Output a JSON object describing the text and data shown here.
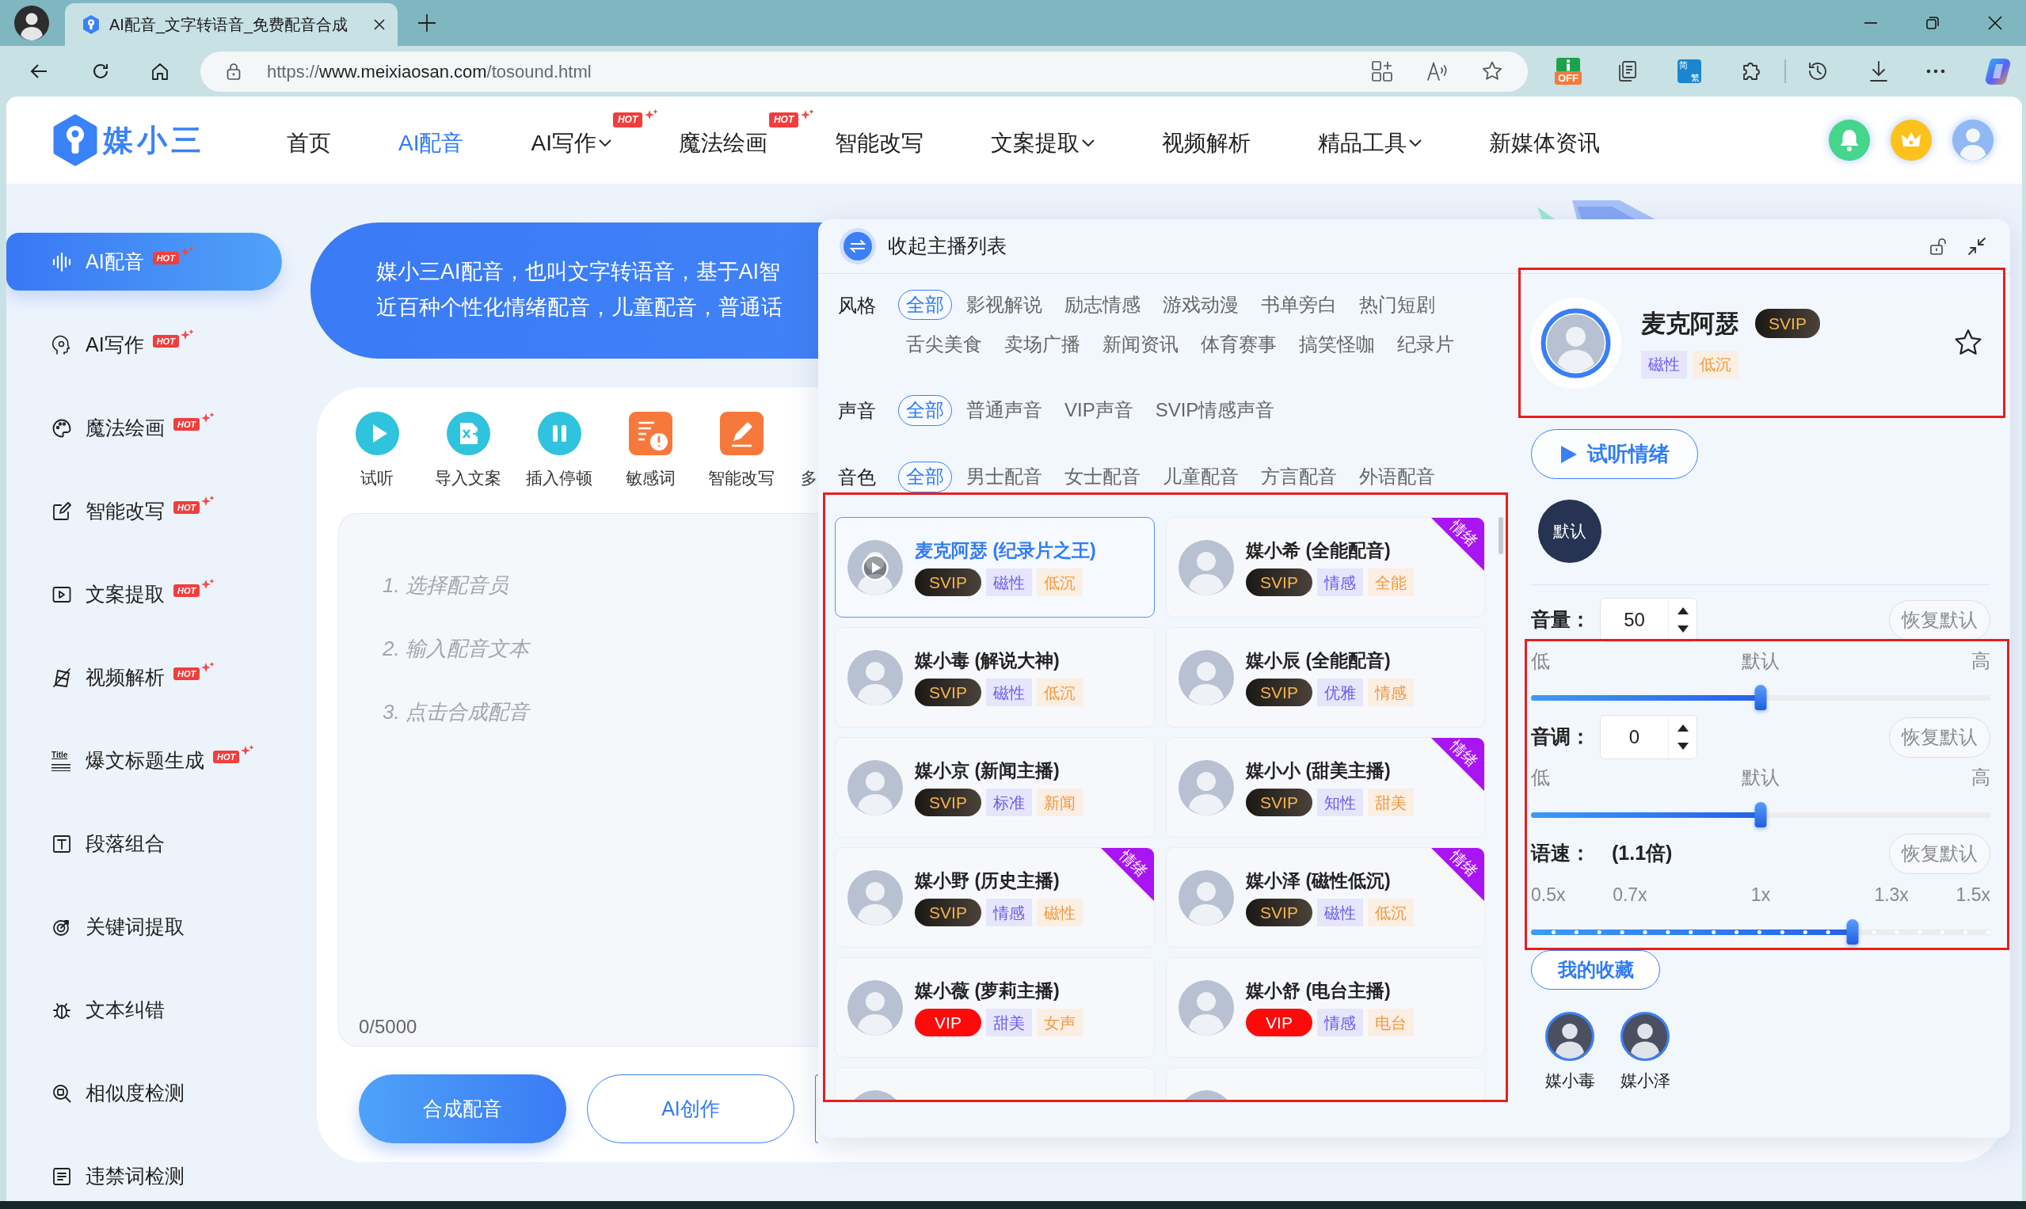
{
  "browser": {
    "tab_title": "AI配音_文字转语音_免费配音合成",
    "url": "https://www.meixiaosan.com/tosound.html",
    "extension_badge": "OFF",
    "translate_badge": [
      "简",
      "繁"
    ]
  },
  "header": {
    "logo": "媒小三",
    "nav": [
      {
        "label": "首页",
        "selected": false,
        "dropdown": false
      },
      {
        "label": "AI配音",
        "selected": true,
        "dropdown": false
      },
      {
        "label": "AI写作",
        "selected": false,
        "dropdown": true,
        "badge": "HOT"
      },
      {
        "label": "魔法绘画",
        "selected": false,
        "dropdown": false,
        "badge": "HOT"
      },
      {
        "label": "智能改写",
        "selected": false,
        "dropdown": false
      },
      {
        "label": "文案提取",
        "selected": false,
        "dropdown": true
      },
      {
        "label": "视频解析",
        "selected": false,
        "dropdown": false
      },
      {
        "label": "精品工具",
        "selected": false,
        "dropdown": true
      },
      {
        "label": "新媒体资讯",
        "selected": false,
        "dropdown": false
      }
    ]
  },
  "sidebar": {
    "items": [
      {
        "label": "AI配音",
        "selected": true,
        "badge": "HOT"
      },
      {
        "label": "AI写作",
        "selected": false,
        "badge": "HOT"
      },
      {
        "label": "魔法绘画",
        "selected": false,
        "badge": "HOT"
      },
      {
        "label": "智能改写",
        "selected": false,
        "badge": "HOT"
      },
      {
        "label": "文案提取",
        "selected": false,
        "badge": "HOT"
      },
      {
        "label": "视频解析",
        "selected": false,
        "badge": "HOT"
      },
      {
        "label": "爆文标题生成",
        "selected": false,
        "badge": "HOT",
        "icon_text": "Title"
      },
      {
        "label": "段落组合",
        "selected": false
      },
      {
        "label": "关键词提取",
        "selected": false
      },
      {
        "label": "文本纠错",
        "selected": false
      },
      {
        "label": "相似度检测",
        "selected": false
      },
      {
        "label": "违禁词检测",
        "selected": false
      }
    ]
  },
  "banner": {
    "lines": [
      "媒小三AI配音，也叫文字转语音，基于AI智",
      "近百种个性化情绪配音，儿童配音，普通话"
    ]
  },
  "editor": {
    "tools": [
      {
        "label": "试听"
      },
      {
        "label": "导入文案"
      },
      {
        "label": "插入停顿"
      },
      {
        "label": "敏感词"
      },
      {
        "label": "智能改写"
      },
      {
        "label": "多",
        "clipped": true
      }
    ],
    "placeholder": [
      "1. 选择配音员",
      "2. 输入配音文本",
      "3. 点击合成配音"
    ],
    "counter": "0/5000",
    "buttons": [
      {
        "label": "合成配音",
        "kind": "primary"
      },
      {
        "label": "AI创作",
        "kind": "outline"
      },
      {
        "kind": "outline"
      }
    ]
  },
  "voice_panel": {
    "collapse_label": "收起主播列表",
    "filters": [
      {
        "label": "风格",
        "options": [
          {
            "label": "全部",
            "selected": true
          },
          {
            "label": "影视解说",
            "selected": false
          },
          {
            "label": "励志情感",
            "selected": false
          },
          {
            "label": "游戏动漫",
            "selected": false
          },
          {
            "label": "书单旁白",
            "selected": false
          },
          {
            "label": "热门短剧",
            "selected": false
          },
          {
            "label": "舌尖美食",
            "selected": false
          },
          {
            "label": "卖场广播",
            "selected": false
          },
          {
            "label": "新闻资讯",
            "selected": false
          },
          {
            "label": "体育赛事",
            "selected": false
          },
          {
            "label": "搞笑怪咖",
            "selected": false
          },
          {
            "label": "纪录片",
            "selected": false
          }
        ]
      },
      {
        "label": "声音",
        "options": [
          {
            "label": "全部",
            "selected": true
          },
          {
            "label": "普通声音",
            "selected": false
          },
          {
            "label": "VIP声音",
            "selected": false
          },
          {
            "label": "SVIP情感声音",
            "selected": false
          }
        ]
      },
      {
        "label": "音色",
        "options": [
          {
            "label": "全部",
            "selected": true
          },
          {
            "label": "男士配音",
            "selected": false
          },
          {
            "label": "女士配音",
            "selected": false
          },
          {
            "label": "儿童配音",
            "selected": false
          },
          {
            "label": "方言配音",
            "selected": false
          },
          {
            "label": "外语配音",
            "selected": false
          }
        ]
      }
    ],
    "voice_list": {
      "highlighted": true,
      "items": [
        {
          "kind": "full",
          "name": "麦克阿瑟 (纪录片之王)",
          "tier": {
            "label": "SVIP",
            "kind": "svip"
          },
          "tags": [
            "磁性",
            "低沉"
          ],
          "selected": true
        },
        {
          "kind": "full",
          "name": "媒小希 (全能配音)",
          "tier": {
            "label": "SVIP",
            "kind": "svip"
          },
          "tags": [
            "情感",
            "全能"
          ],
          "selected": false,
          "ribbon": "情绪"
        },
        {
          "kind": "full",
          "name": "媒小毒 (解说大神)",
          "tier": {
            "label": "SVIP",
            "kind": "svip"
          },
          "tags": [
            "磁性",
            "低沉"
          ],
          "selected": false
        },
        {
          "kind": "full",
          "name": "媒小辰 (全能配音)",
          "tier": {
            "label": "SVIP",
            "kind": "svip"
          },
          "tags": [
            "优雅",
            "情感"
          ],
          "selected": false
        },
        {
          "kind": "full",
          "name": "媒小京 (新闻主播)",
          "tier": {
            "label": "SVIP",
            "kind": "svip"
          },
          "tags": [
            "标准",
            "新闻"
          ],
          "selected": false
        },
        {
          "kind": "full",
          "name": "媒小小 (甜美主播)",
          "tier": {
            "label": "SVIP",
            "kind": "svip"
          },
          "tags": [
            "知性",
            "甜美"
          ],
          "selected": false,
          "ribbon": "情绪"
        },
        {
          "kind": "full",
          "name": "媒小野 (历史主播)",
          "tier": {
            "label": "SVIP",
            "kind": "svip"
          },
          "tags": [
            "情感",
            "磁性"
          ],
          "selected": false,
          "ribbon": "情绪"
        },
        {
          "kind": "full",
          "name": "媒小泽 (磁性低沉)",
          "tier": {
            "label": "SVIP",
            "kind": "svip"
          },
          "tags": [
            "磁性",
            "低沉"
          ],
          "selected": false,
          "ribbon": "情绪"
        },
        {
          "kind": "full",
          "name": "媒小薇 (萝莉主播)",
          "tier": {
            "label": "VIP",
            "kind": "vip"
          },
          "tags": [
            "甜美",
            "女声"
          ],
          "selected": false
        },
        {
          "kind": "full",
          "name": "媒小舒 (电台主播)",
          "tier": {
            "label": "VIP",
            "kind": "vip"
          },
          "tags": [
            "情感",
            "电台"
          ],
          "selected": false
        },
        {
          "kind": "partial",
          "selected": false
        },
        {
          "kind": "partial",
          "selected": false
        }
      ]
    },
    "detail": {
      "highlighted": true,
      "name": "麦克阿瑟",
      "tier": {
        "label": "SVIP",
        "kind": "svip"
      },
      "tags": [
        "磁性",
        "低沉"
      ],
      "favorite": false,
      "preview_label": "试听情绪",
      "emotions": [
        {
          "label": "默认",
          "selected": true
        }
      ]
    },
    "adjustments": {
      "highlighted": true,
      "volume": {
        "label": "音量：",
        "value": "50",
        "reset": "恢复默认",
        "scale": [
          "低",
          "默认",
          "高"
        ],
        "level": 0.5
      },
      "pitch": {
        "label": "音调：",
        "value": "0",
        "reset": "恢复默认",
        "scale": [
          "低",
          "默认",
          "高"
        ],
        "level": 0.5
      },
      "speed": {
        "label": "语速：",
        "value": "(1.1倍)",
        "reset": "恢复默认",
        "ticks": [
          "0.5x",
          "0.7x",
          "1x",
          "1.3x",
          "1.5x"
        ],
        "level": 0.7
      }
    },
    "favorites": {
      "title": "我的收藏",
      "items": [
        {
          "name": "媒小毒"
        },
        {
          "name": "媒小泽"
        }
      ]
    }
  }
}
